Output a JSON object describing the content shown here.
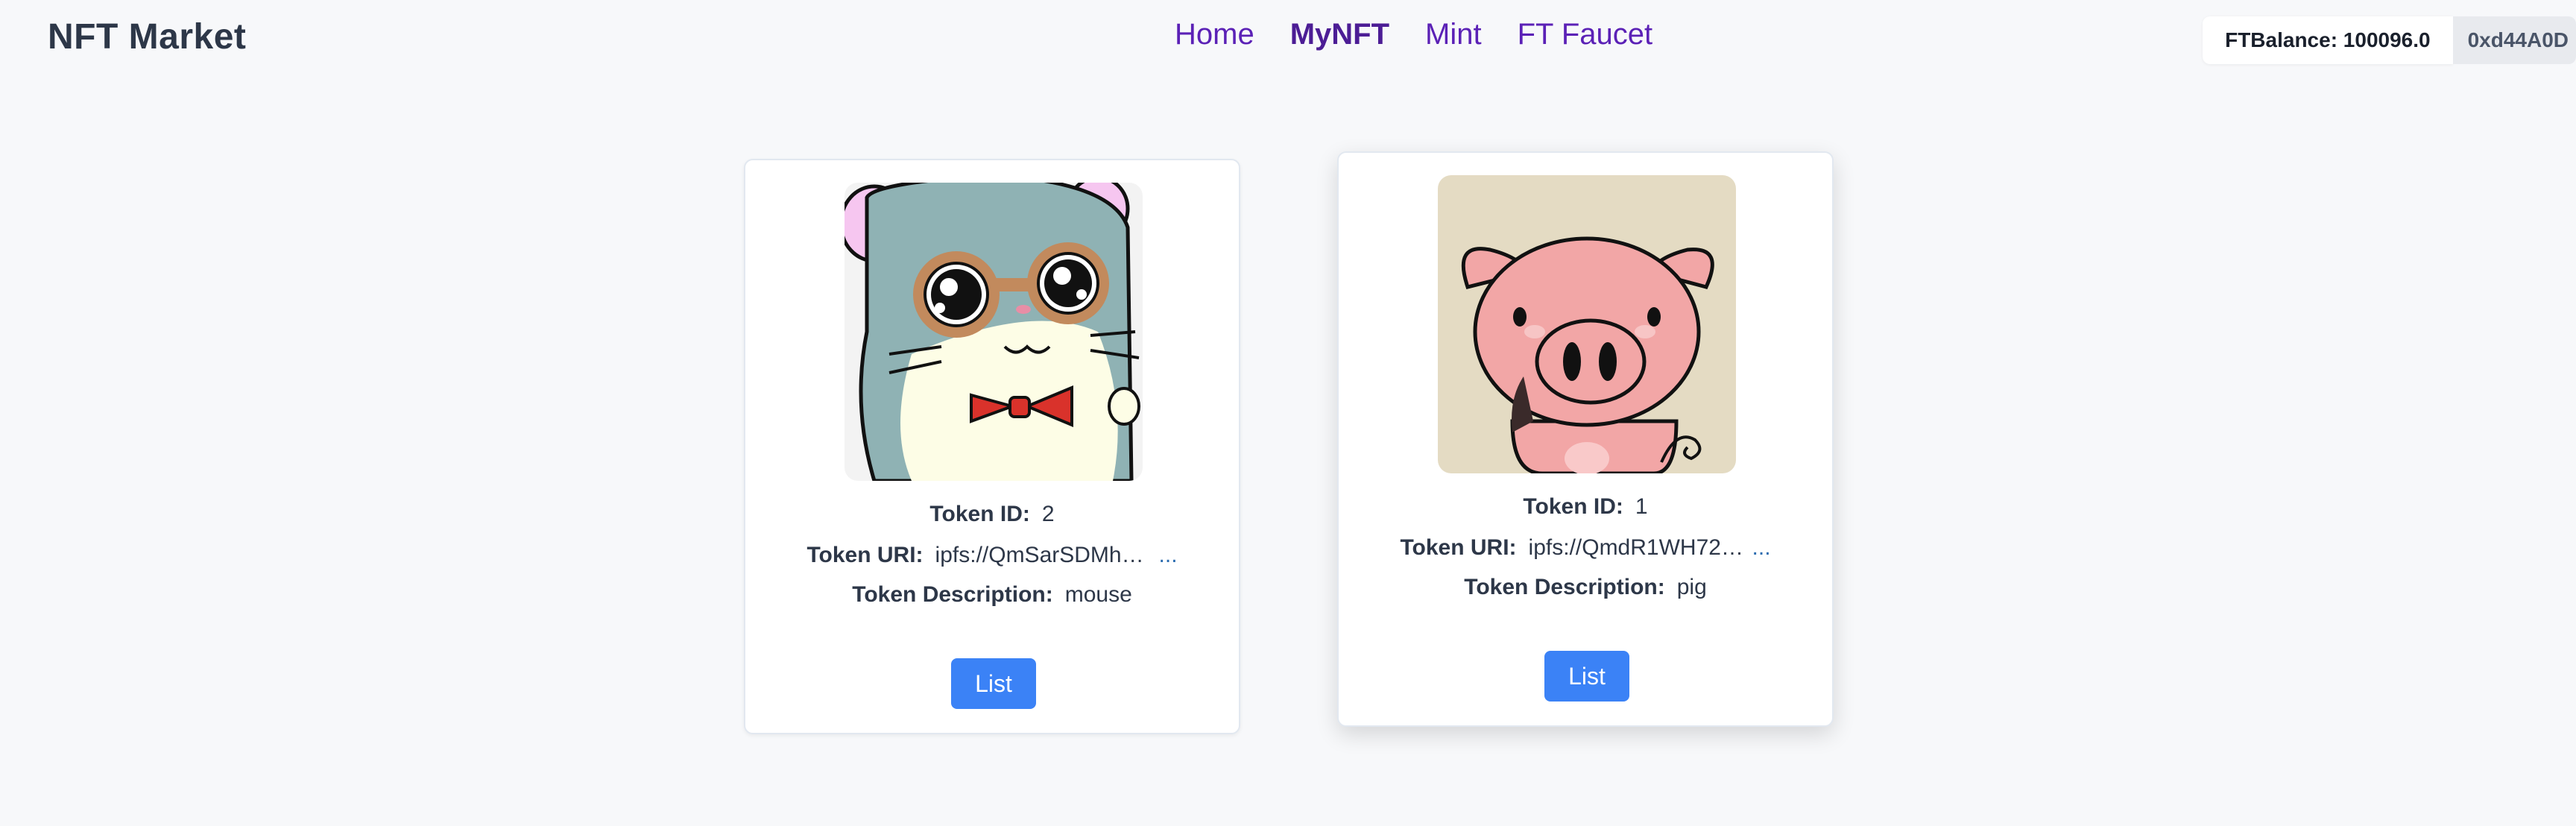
{
  "header": {
    "brand": "NFT Market",
    "nav": [
      "Home",
      "MyNFT",
      "Mint",
      "FT Faucet"
    ],
    "active_nav": "MyNFT",
    "balance": "FTBalance: 100096.0",
    "address": "0xd44A0D"
  },
  "cards": [
    {
      "image": "mouse-nft-image",
      "token_id_label": "Token ID:",
      "token_id": "2",
      "uri_label": "Token URI:",
      "uri": "ipfs://QmSarSDMhu...",
      "more": "...",
      "desc_label": "Token Description:",
      "description": "mouse",
      "button": "List"
    },
    {
      "image": "pig-nft-image",
      "token_id_label": "Token ID:",
      "token_id": "1",
      "uri_label": "Token URI:",
      "uri": "ipfs://QmdR1WH72c...",
      "more": "...",
      "desc_label": "Token Description:",
      "description": "pig",
      "button": "List"
    }
  ],
  "colors": {
    "accent": "#3b82f6",
    "nav": "#5b21b6",
    "link": "#2b6cb0",
    "background": "#f7f8fa"
  }
}
